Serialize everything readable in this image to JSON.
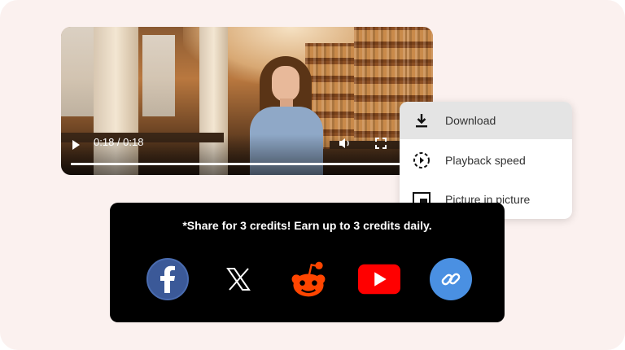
{
  "player": {
    "time": "0:18 / 0:18",
    "progress": 1.0,
    "icons": [
      "play-icon",
      "volume-icon",
      "fullscreen-icon"
    ]
  },
  "menu": {
    "items": [
      {
        "label": "Download",
        "icon": "download-icon",
        "active": true
      },
      {
        "label": "Playback speed",
        "icon": "playback-speed-icon",
        "active": false
      },
      {
        "label": "Picture in picture",
        "icon": "picture-in-picture-icon",
        "active": false
      }
    ]
  },
  "share": {
    "text": "*Share for 3 credits! Earn up to 3 credits daily.",
    "buttons": [
      {
        "name": "facebook",
        "icon": "facebook-icon",
        "color": "#3b5998"
      },
      {
        "name": "x",
        "icon": "x-icon",
        "color": "#ffffff"
      },
      {
        "name": "reddit",
        "icon": "reddit-icon",
        "color": "#ff4500"
      },
      {
        "name": "youtube",
        "icon": "youtube-icon",
        "color": "#ff0000"
      },
      {
        "name": "copy-link",
        "icon": "link-icon",
        "color": "#4a90e2"
      }
    ]
  },
  "colors": {
    "background": "#fbf1ef",
    "panel": "#000000",
    "menu_active": "#e4e4e4"
  }
}
